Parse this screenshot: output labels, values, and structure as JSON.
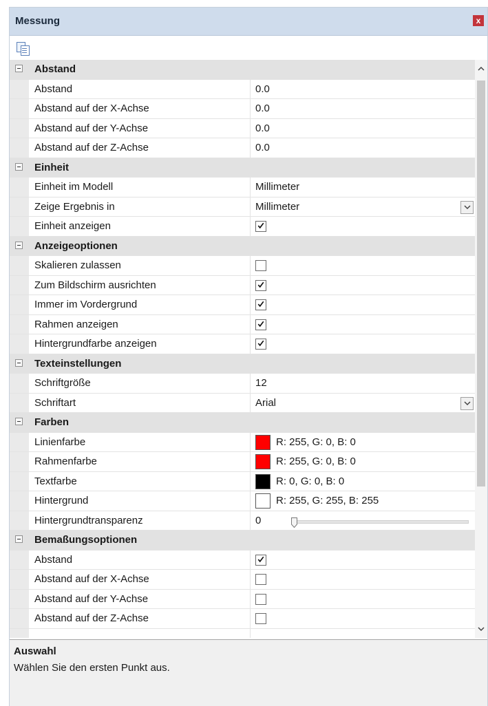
{
  "window": {
    "title": "Messung",
    "close_icon": "close-icon",
    "close_glyph": "x"
  },
  "toolbar": {
    "copy_icon": "copy-icon"
  },
  "categories": [
    {
      "label": "Abstand",
      "props": [
        {
          "name": "Abstand",
          "type": "text",
          "value": "0.0"
        },
        {
          "name": "Abstand auf der X-Achse",
          "type": "text",
          "value": "0.0"
        },
        {
          "name": "Abstand auf der Y-Achse",
          "type": "text",
          "value": "0.0"
        },
        {
          "name": "Abstand auf der Z-Achse",
          "type": "text",
          "value": "0.0"
        }
      ]
    },
    {
      "label": "Einheit",
      "props": [
        {
          "name": "Einheit im Modell",
          "type": "text",
          "value": "Millimeter"
        },
        {
          "name": "Zeige Ergebnis in",
          "type": "dropdown",
          "value": "Millimeter"
        },
        {
          "name": "Einheit anzeigen",
          "type": "checkbox",
          "checked": true
        }
      ]
    },
    {
      "label": "Anzeigeoptionen",
      "props": [
        {
          "name": "Skalieren zulassen",
          "type": "checkbox",
          "checked": false
        },
        {
          "name": "Zum Bildschirm ausrichten",
          "type": "checkbox",
          "checked": true
        },
        {
          "name": "Immer im Vordergrund",
          "type": "checkbox",
          "checked": true
        },
        {
          "name": "Rahmen anzeigen",
          "type": "checkbox",
          "checked": true
        },
        {
          "name": "Hintergrundfarbe anzeigen",
          "type": "checkbox",
          "checked": true
        }
      ]
    },
    {
      "label": "Texteinstellungen",
      "props": [
        {
          "name": "Schriftgröße",
          "type": "text",
          "value": "12"
        },
        {
          "name": "Schriftart",
          "type": "dropdown",
          "value": "Arial"
        }
      ]
    },
    {
      "label": "Farben",
      "props": [
        {
          "name": "Linienfarbe",
          "type": "color",
          "color": "#ff0000",
          "value": "R: 255, G: 0, B: 0"
        },
        {
          "name": "Rahmenfarbe",
          "type": "color",
          "color": "#ff0000",
          "value": "R: 255, G: 0, B: 0"
        },
        {
          "name": "Textfarbe",
          "type": "color",
          "color": "#000000",
          "value": "R: 0, G: 0, B: 0"
        },
        {
          "name": "Hintergrund",
          "type": "color",
          "color": "#ffffff",
          "value": "R: 255, G: 255, B: 255"
        },
        {
          "name": "Hintergrundtransparenz",
          "type": "slider",
          "value": "0",
          "level": 0
        }
      ]
    },
    {
      "label": "Bemaßungsoptionen",
      "props": [
        {
          "name": "Abstand",
          "type": "checkbox",
          "checked": true
        },
        {
          "name": "Abstand auf der X-Achse",
          "type": "checkbox",
          "checked": false
        },
        {
          "name": "Abstand auf der Y-Achse",
          "type": "checkbox",
          "checked": false
        },
        {
          "name": "Abstand auf der Z-Achse",
          "type": "checkbox",
          "checked": false
        },
        {
          "name": "",
          "type": "text",
          "value": ""
        }
      ]
    }
  ],
  "help": {
    "title": "Auswahl",
    "text": "Wählen Sie den ersten Punkt aus."
  }
}
